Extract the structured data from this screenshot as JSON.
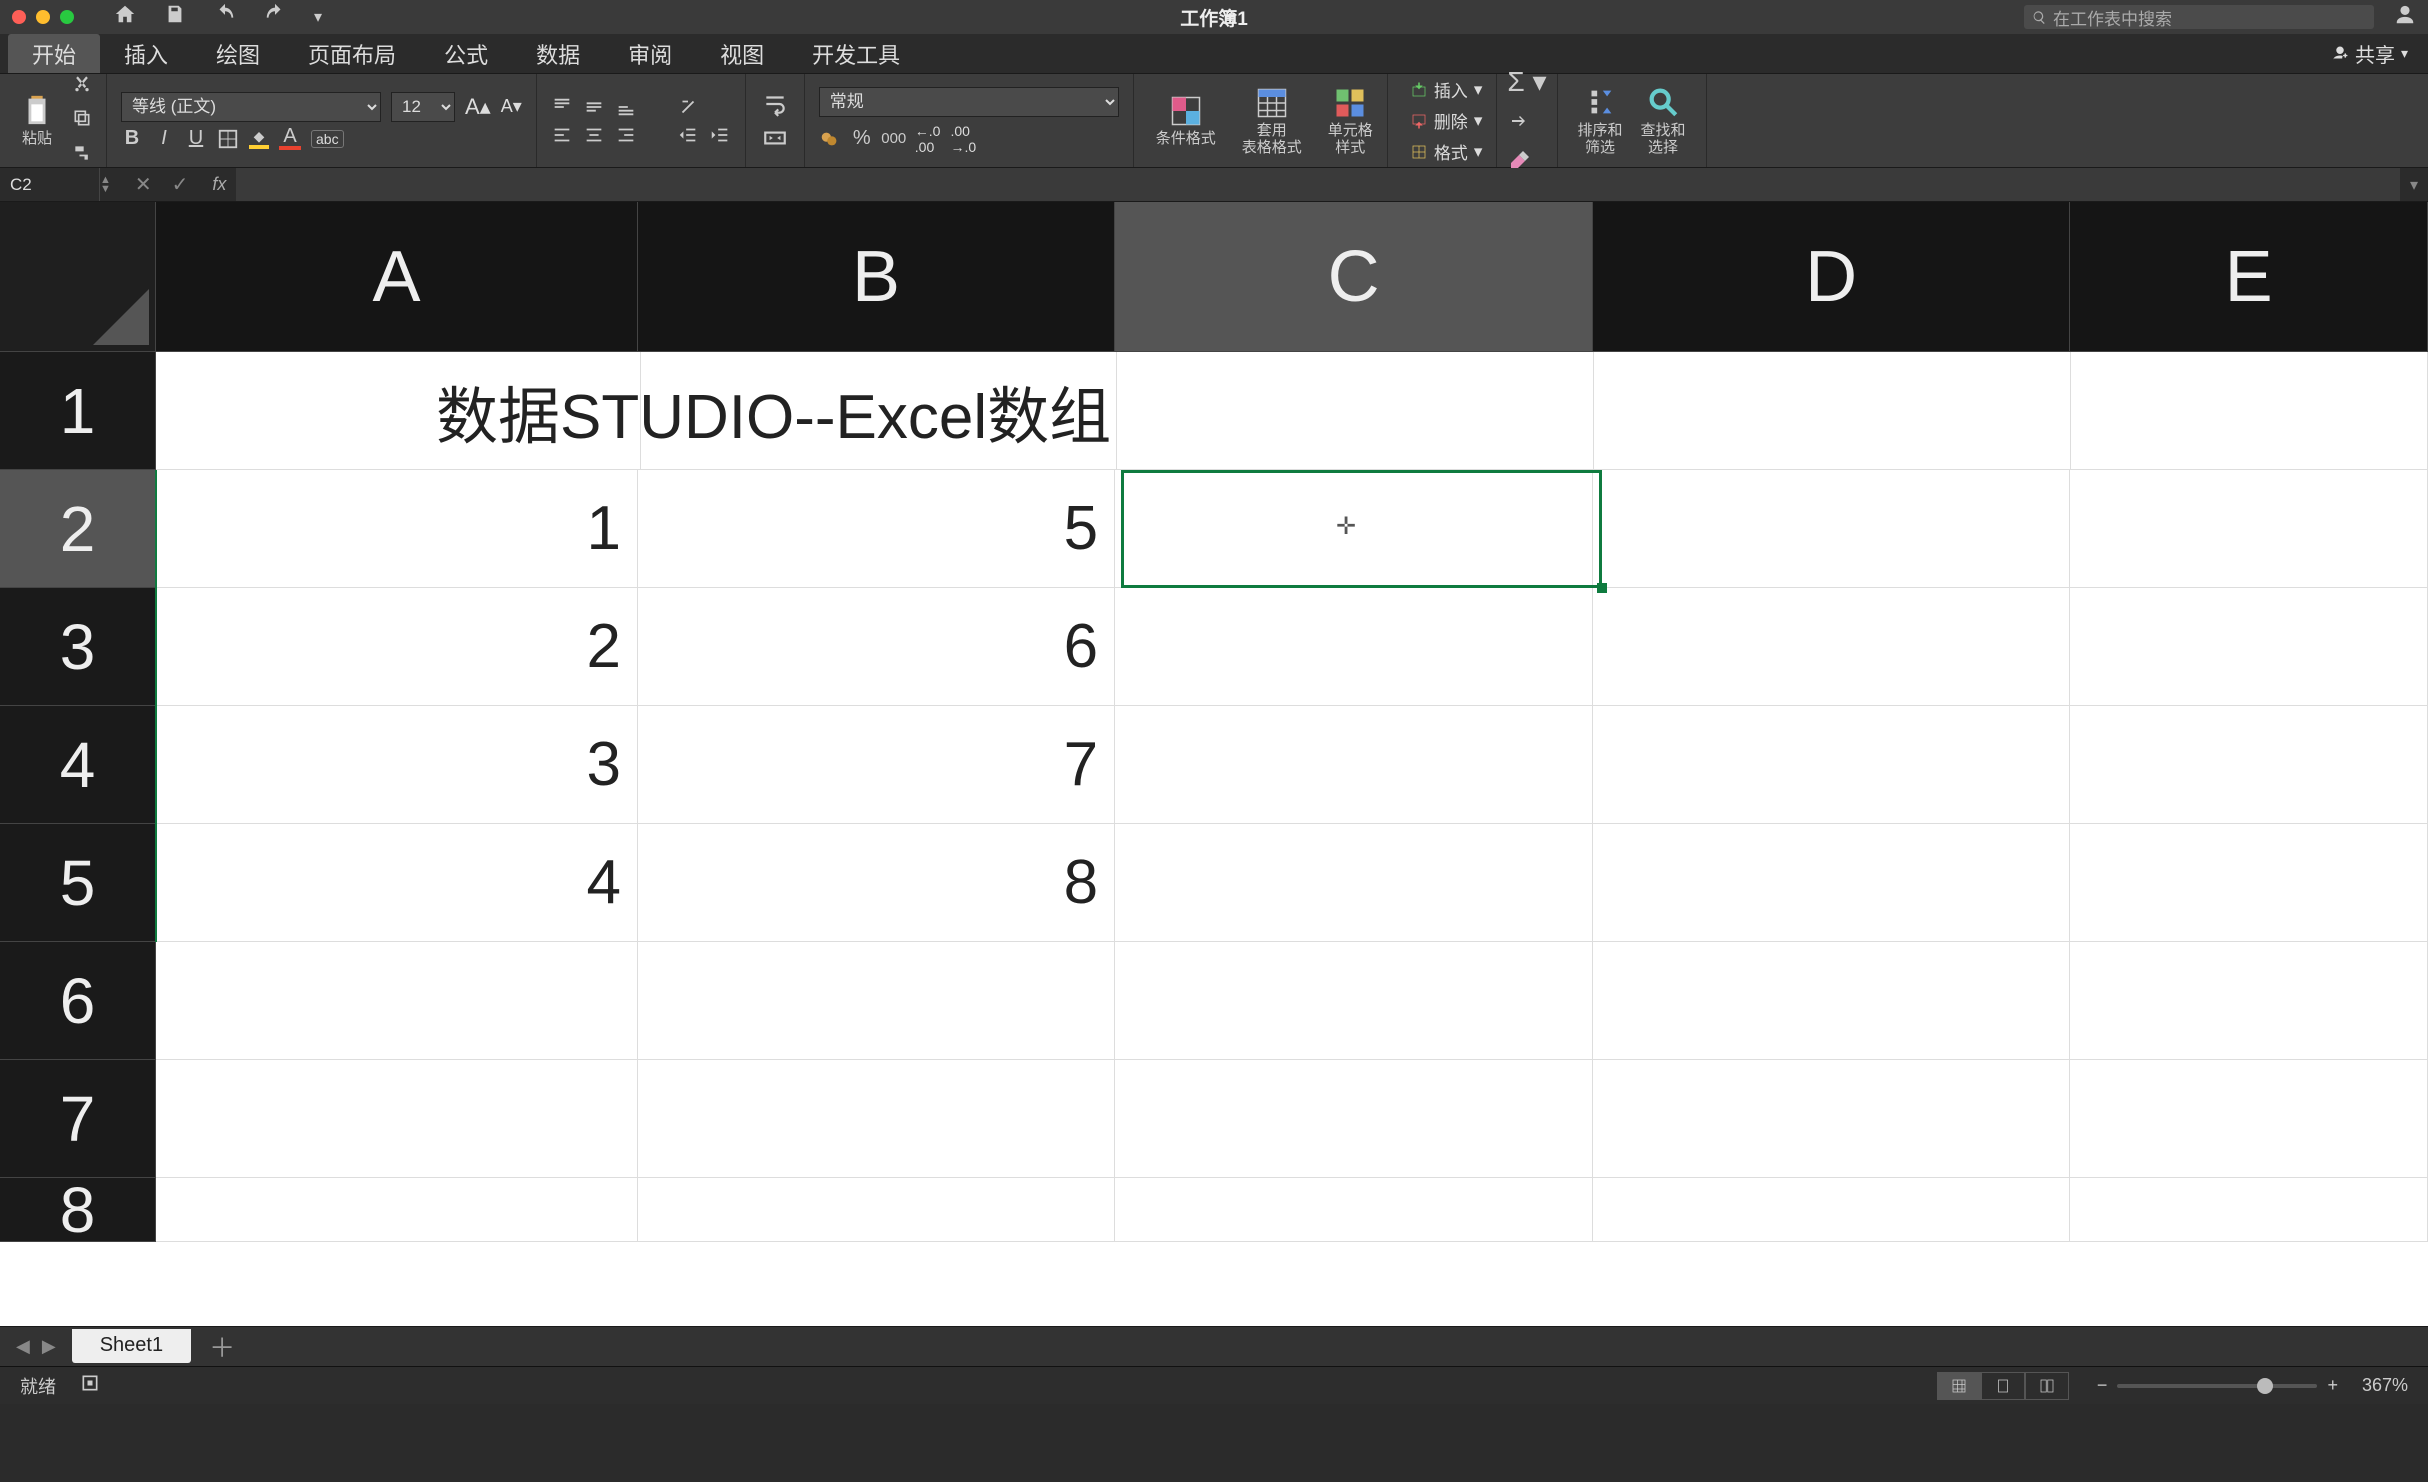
{
  "title": "工作簿1",
  "search_placeholder": "在工作表中搜索",
  "tabs": [
    "开始",
    "插入",
    "绘图",
    "页面布局",
    "公式",
    "数据",
    "审阅",
    "视图",
    "开发工具"
  ],
  "active_tab": 0,
  "share_label": "共享",
  "paste_label": "粘贴",
  "font": {
    "name": "等线 (正文)",
    "size": "12"
  },
  "number_format": "常规",
  "styles": {
    "cond": "条件格式",
    "table": "套用\n表格格式",
    "cell": "单元格\n样式"
  },
  "cells_menu": {
    "insert": "插入",
    "delete": "删除",
    "format": "格式"
  },
  "editing": {
    "sort": "排序和\n筛选",
    "find": "查找和\n选择"
  },
  "name_box": "C2",
  "formula": "",
  "columns": [
    "A",
    "B",
    "C",
    "D",
    "E"
  ],
  "rows": [
    "1",
    "2",
    "3",
    "4",
    "5",
    "6",
    "7",
    "8"
  ],
  "merged_header": "数据STUDIO--Excel数组",
  "data": {
    "A2": "1",
    "A3": "2",
    "A4": "3",
    "A5": "4",
    "B2": "5",
    "B3": "6",
    "B4": "7",
    "B5": "8"
  },
  "selected_cell": "C2",
  "sheet_tab": "Sheet1",
  "status": "就绪",
  "zoom": "367%"
}
